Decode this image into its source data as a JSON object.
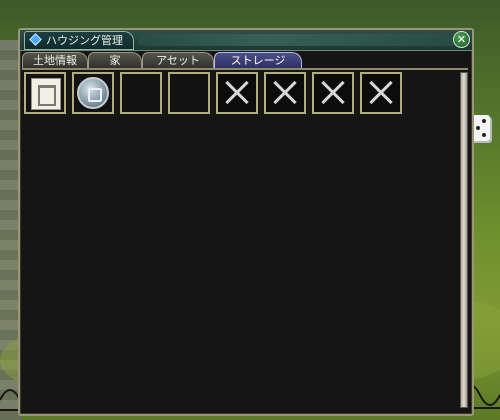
{
  "window": {
    "title": "ハウジング管理",
    "close_label": "✕"
  },
  "tabs": [
    {
      "label": "土地情報",
      "active": false
    },
    {
      "label": "家",
      "active": false
    },
    {
      "label": "アセット",
      "active": false
    },
    {
      "label": "ストレージ",
      "active": true
    }
  ],
  "storage_slots": [
    {
      "state": "item",
      "icon": "scroll-icon"
    },
    {
      "state": "item",
      "icon": "coin-icon"
    },
    {
      "state": "empty"
    },
    {
      "state": "empty"
    },
    {
      "state": "locked"
    },
    {
      "state": "locked"
    },
    {
      "state": "locked"
    },
    {
      "state": "locked"
    }
  ],
  "colors": {
    "frame": "#b5ad7c",
    "active_tab": "#4b4f8a",
    "title_bar": "#2f4f47"
  }
}
